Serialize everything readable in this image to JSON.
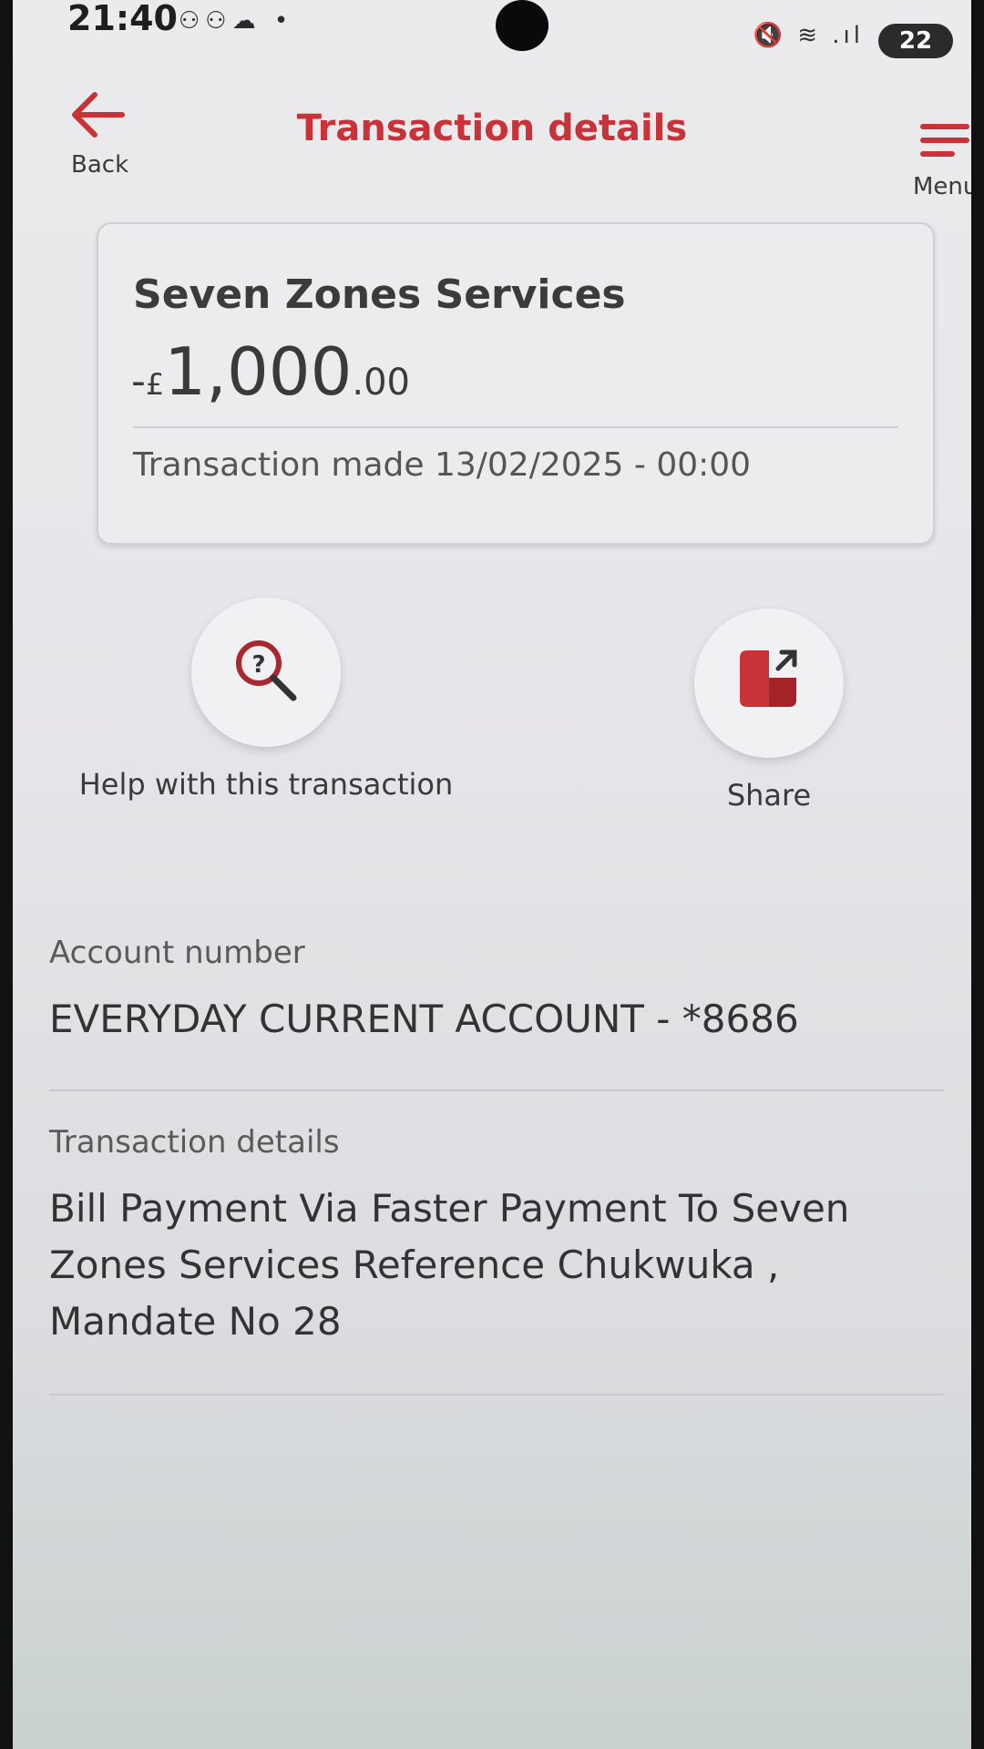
{
  "status_bar": {
    "time": "21:40",
    "left_icons": "⚇⚇☁ •",
    "right_icons": "🔇 ≋ .ıl",
    "battery": "22"
  },
  "header": {
    "back_label": "Back",
    "title": "Transaction details",
    "menu_label": "Menu"
  },
  "card": {
    "payee": "Seven Zones Services",
    "amount_sign": "-",
    "amount_currency": "£",
    "amount_main": "1,000",
    "amount_decimal": ".00",
    "transaction_made": "Transaction made 13/02/2025 - 00:00"
  },
  "actions": {
    "help_label": "Help with this transaction",
    "share_label": "Share"
  },
  "details": {
    "account_label": "Account number",
    "account_value": "EVERYDAY CURRENT ACCOUNT - *8686",
    "transaction_label": "Transaction details",
    "transaction_value": "Bill Payment Via Faster Payment To Seven Zones Services Reference Chukwuka , Mandate No 28"
  },
  "colors": {
    "accent": "#c8333a"
  }
}
